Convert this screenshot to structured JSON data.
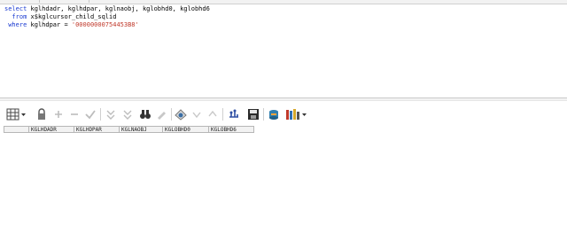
{
  "sql": {
    "lines": [
      {
        "kw": "select ",
        "rest": "kglhdadr, kglhdpar, kglnaobj, kglobhd0, kglobhd6",
        "str": ""
      },
      {
        "kw": "  from ",
        "rest": "x$kglcursor_child_sqlid",
        "str": ""
      },
      {
        "kw": " where ",
        "rest": "kglhdpar = ",
        "str": "'00000000754453B8'"
      }
    ]
  },
  "toolbar": {
    "icons": [
      "grid-dropdown-icon",
      "lock-icon",
      "add-record-icon",
      "delete-record-icon",
      "post-changes-icon",
      "filter-icon",
      "filter-clear-icon",
      "find-binoculars-icon",
      "clear-icon",
      "query-by-example-icon",
      "nav-down-icon",
      "nav-up-icon",
      "export-connect-icon",
      "save-disk-icon",
      "record-db-icon",
      "chart-books-dropdown-icon"
    ]
  },
  "grid": {
    "columns": [
      "KGLHDADR",
      "KGLHDPAR",
      "KGLNAOBJ",
      "KGLOBHD0",
      "KGLOBHD6"
    ]
  }
}
